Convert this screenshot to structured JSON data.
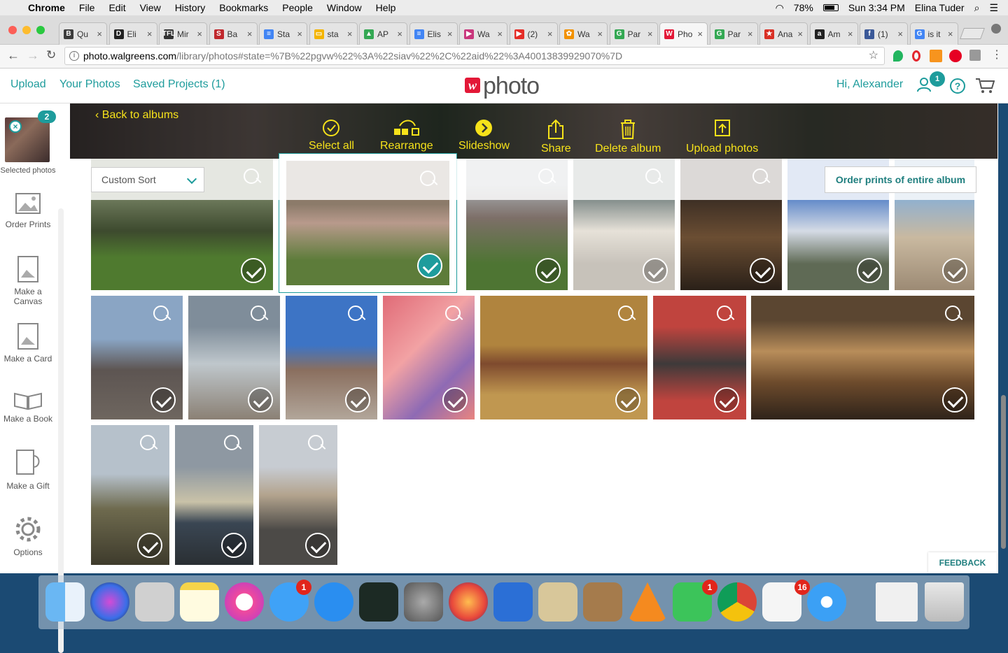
{
  "menubar": {
    "app": "Chrome",
    "items": [
      "File",
      "Edit",
      "View",
      "History",
      "Bookmarks",
      "People",
      "Window",
      "Help"
    ],
    "battery": "78%",
    "clock": "Sun 3:34 PM",
    "user": "Elina Tuder"
  },
  "tabs": [
    {
      "label": "Qu",
      "fav": "B",
      "color": "#3d3d3d"
    },
    {
      "label": "Eli",
      "fav": "D",
      "color": "#222"
    },
    {
      "label": "Mir",
      "fav": "TFL",
      "color": "#333"
    },
    {
      "label": "Ba",
      "fav": "S",
      "color": "#c0282d"
    },
    {
      "label": "Sta",
      "fav": "≡",
      "color": "#4285f4"
    },
    {
      "label": "sta",
      "fav": "▭",
      "color": "#f4b400"
    },
    {
      "label": "AP",
      "fav": "▲",
      "color": "#34a853"
    },
    {
      "label": "Elis",
      "fav": "≡",
      "color": "#4285f4"
    },
    {
      "label": "Wa",
      "fav": "▶",
      "color": "#c9367c"
    },
    {
      "label": "(2)",
      "fav": "▶",
      "color": "#e52d27"
    },
    {
      "label": "Wa",
      "fav": "✿",
      "color": "#f29100"
    },
    {
      "label": "Par",
      "fav": "G",
      "color": "#34a853"
    },
    {
      "label": "Pho",
      "fav": "W",
      "color": "#e31837"
    },
    {
      "label": "Par",
      "fav": "G",
      "color": "#34a853"
    },
    {
      "label": "Ana",
      "fav": "★",
      "color": "#d93025"
    },
    {
      "label": "Am",
      "fav": "a",
      "color": "#222"
    },
    {
      "label": "(1)",
      "fav": "f",
      "color": "#3b5998"
    },
    {
      "label": "is it",
      "fav": "G",
      "color": "#4285f4"
    }
  ],
  "address": {
    "domain": "photo.walgreens.com",
    "path": "/library/photos#state=%7B%22pgvw%22%3A%22siav%22%2C%22aid%22%3A40013839929070%7D"
  },
  "header": {
    "upload": "Upload",
    "your_photos": "Your Photos",
    "saved_projects": "Saved Projects (1)",
    "logo_text": "photo",
    "greeting": "Hi, Alexander",
    "notif_count": "1"
  },
  "sidebar": {
    "selected_count": "2",
    "selected_label": "Selected photos",
    "items": [
      "Order Prints",
      "Make a Canvas",
      "Make a Card",
      "Make a Book",
      "Make a Gift",
      "Options"
    ]
  },
  "album": {
    "back": "Back to albums",
    "actions": [
      "Select all",
      "Rearrange",
      "Slideshow",
      "Share",
      "Delete album",
      "Upload photos"
    ],
    "sort": "Custom Sort",
    "order_all": "Order prints of entire album"
  },
  "feedback": "FEEDBACK",
  "dock": {
    "badges": {
      "messages": "1",
      "facetime": "1",
      "reminders": "16"
    }
  },
  "colors": {
    "accent": "#1e9c9c",
    "banner_text": "#f6e21a",
    "brand_red": "#e31837"
  }
}
